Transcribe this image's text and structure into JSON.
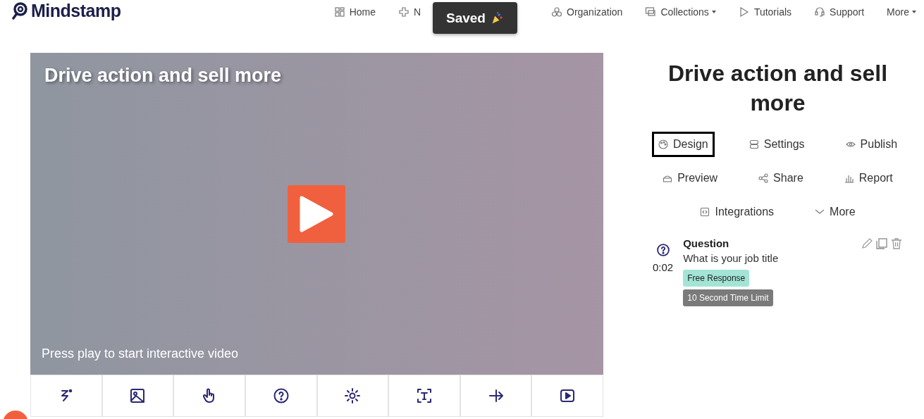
{
  "logo": {
    "text": "Mindstamp"
  },
  "nav": [
    {
      "label": "Home",
      "caret": false
    },
    {
      "label": "N",
      "caret": false
    },
    {
      "label": "Organization",
      "caret": false
    },
    {
      "label": "Collections",
      "caret": true
    },
    {
      "label": "Tutorials",
      "caret": false
    },
    {
      "label": "Support",
      "caret": false
    },
    {
      "label": "More",
      "caret": true
    }
  ],
  "toast": {
    "text": "Saved"
  },
  "video": {
    "title": "Drive action and sell more",
    "caption": "Press play to start interactive video"
  },
  "panel": {
    "title": "Drive action and sell more",
    "tabs": [
      [
        {
          "label": "Design",
          "selected": true
        },
        {
          "label": "Settings",
          "selected": false
        },
        {
          "label": "Publish",
          "selected": false
        }
      ],
      [
        {
          "label": "Preview",
          "selected": false
        },
        {
          "label": "Share",
          "selected": false
        },
        {
          "label": "Report",
          "selected": false
        }
      ],
      [
        {
          "label": "Integrations",
          "selected": false
        },
        {
          "label": "More",
          "selected": false
        }
      ]
    ],
    "interactions": [
      {
        "time": "0:02",
        "type": "Question",
        "text": "What is your job title",
        "tags": [
          {
            "label": "Free Response",
            "color": "#a3e4d7"
          },
          {
            "label": "10 Second Time Limit",
            "color": "#7a7a7a"
          }
        ]
      }
    ]
  }
}
